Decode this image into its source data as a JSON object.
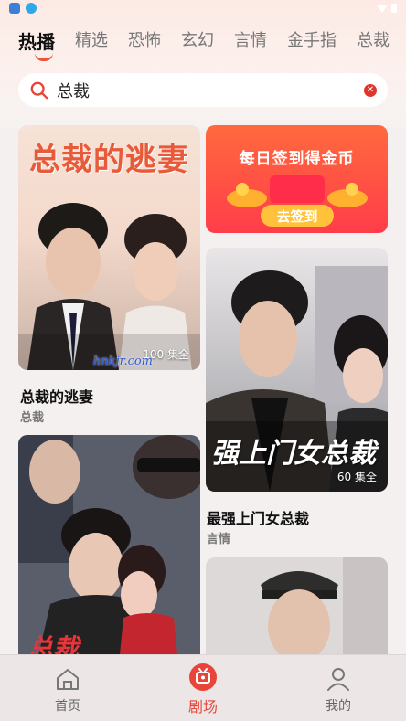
{
  "tabs": [
    "热播",
    "精选",
    "恐怖",
    "玄幻",
    "言情",
    "金手指",
    "总裁"
  ],
  "search": {
    "query": "总裁"
  },
  "cards": [
    {
      "title": "总裁的逃妻",
      "tag": "总裁",
      "episodes": "100 集全",
      "poster_text": "总裁的逃妻",
      "watermark": "hnkjr.com"
    },
    {
      "title": "最强上门女总裁",
      "tag": "言情",
      "episodes": "60 集全",
      "poster_text": "强上门女总裁"
    }
  ],
  "banner": {
    "title": "每日签到得金币",
    "button": "去签到"
  },
  "nav": [
    {
      "label": "首页",
      "icon": "home-icon"
    },
    {
      "label": "剧场",
      "icon": "theater-icon"
    },
    {
      "label": "我的",
      "icon": "profile-icon"
    }
  ],
  "colors": {
    "accent": "#f0523a",
    "active_nav": "#e8443a",
    "banner_top": "#ff6a3d",
    "banner_bottom": "#ff3d4a"
  }
}
